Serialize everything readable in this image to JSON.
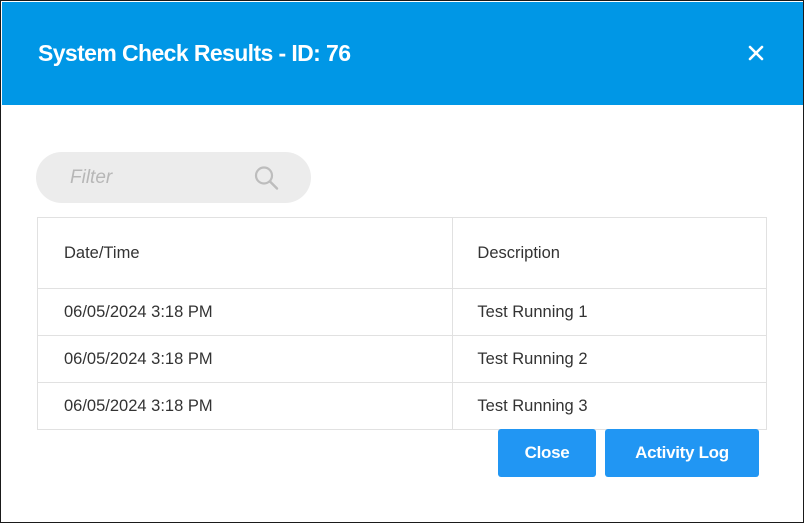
{
  "dialog": {
    "title": "System Check Results - ID: 76",
    "header_color": "#0097e6",
    "close_icon": "close-icon"
  },
  "filter": {
    "placeholder": "Filter",
    "value": "",
    "icon": "search-icon"
  },
  "table": {
    "columns": [
      "Date/Time",
      "Description"
    ],
    "rows": [
      [
        "06/05/2024 3:18 PM",
        "Test Running 1"
      ],
      [
        "06/05/2024 3:18 PM",
        "Test Running 2"
      ],
      [
        "06/05/2024 3:18 PM",
        "Test Running 3"
      ]
    ]
  },
  "buttons": {
    "close_label": "Close",
    "activity_log_label": "Activity Log",
    "color": "#2196f3"
  }
}
